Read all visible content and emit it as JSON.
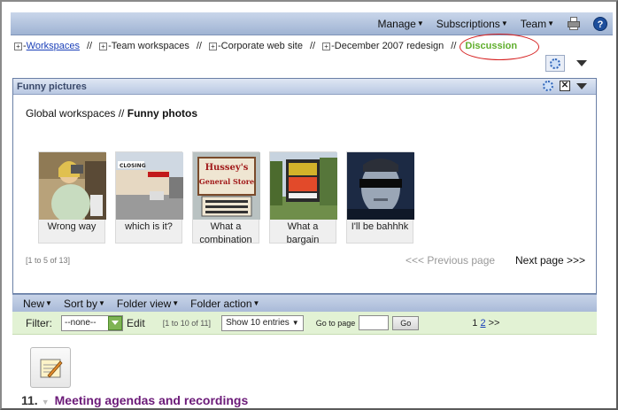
{
  "topbar": {
    "menus": [
      "Manage",
      "Subscriptions",
      "Team"
    ]
  },
  "breadcrumb": {
    "items": [
      "Workspaces",
      "Team workspaces",
      "Corporate web site",
      "December 2007 redesign"
    ],
    "separator": "//",
    "current": "Discussion"
  },
  "portlet": {
    "title": "Funny pictures",
    "path_prefix": "Global workspaces //",
    "path_bold": "Funny photos",
    "photos": [
      {
        "caption_1": "Wrong way",
        "caption_2": ""
      },
      {
        "caption_1": "which is it?",
        "caption_2": ""
      },
      {
        "caption_1": "What a",
        "caption_2": "combination"
      },
      {
        "caption_1": "What a",
        "caption_2": "bargain"
      },
      {
        "caption_1": "I'll be bahhhk",
        "caption_2": ""
      }
    ],
    "count_text": "[1 to 5 of 13]",
    "prev_page": "<<< Previous page",
    "next_page": "Next page >>>"
  },
  "folder_toolbar": {
    "items": [
      "New",
      "Sort by",
      "Folder view",
      "Folder action"
    ]
  },
  "filter": {
    "label": "Filter:",
    "selected": "--none--",
    "edit": "Edit",
    "range": "[1 to 10 of 11]",
    "entries": "Show 10 entries",
    "goto_label": "Go to page",
    "go_button": "Go",
    "page_1": "1",
    "page_2": "2",
    "next": ">>"
  },
  "list": {
    "item_number": "11.",
    "item_title": "Meeting agendas and recordings"
  },
  "colors": {
    "current_crumb": "#5fae2c",
    "item_title": "#6b1a78",
    "highlight": "#d62020"
  }
}
